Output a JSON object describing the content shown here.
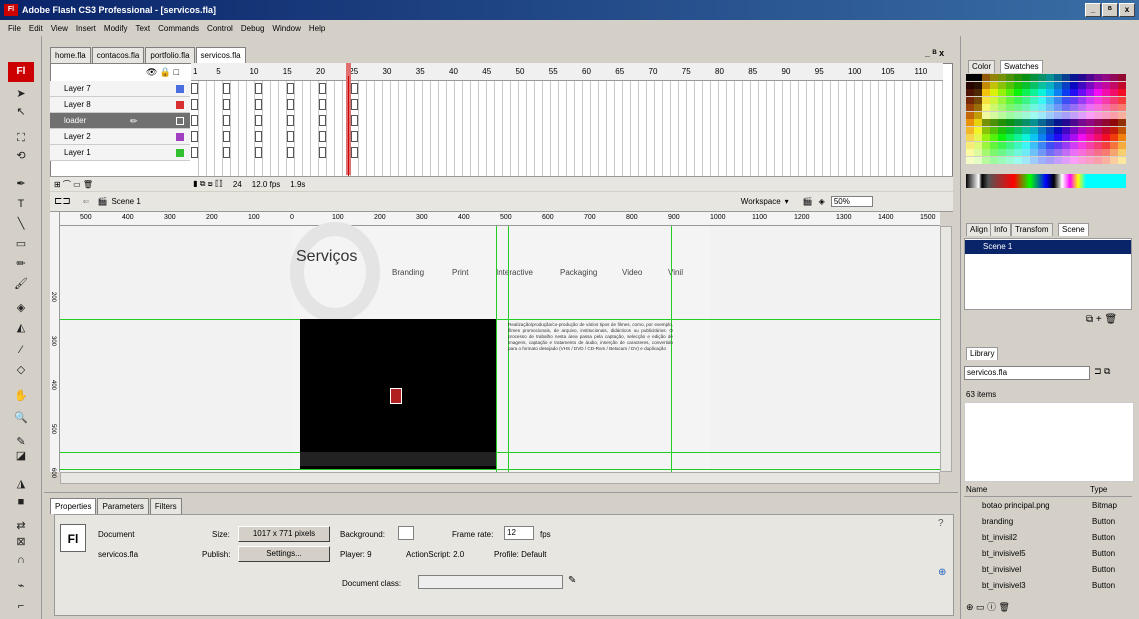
{
  "window": {
    "title": "Adobe Flash CS3 Professional - [servicos.fla]",
    "logo_text": "Fl",
    "min": "_",
    "restore": "ᴮ",
    "close": "x"
  },
  "menu": [
    "File",
    "Edit",
    "View",
    "Insert",
    "Modify",
    "Text",
    "Commands",
    "Control",
    "Debug",
    "Window",
    "Help"
  ],
  "toolbox": {
    "logo": "Fl"
  },
  "doc_tabs": [
    "home.fla",
    "contacos.fla",
    "portfolio.fla",
    "servicos.fla"
  ],
  "timeline": {
    "frame_numbers": [
      "1",
      "5",
      "10",
      "15",
      "20",
      "25",
      "30",
      "35",
      "40",
      "45",
      "50",
      "55",
      "60",
      "65",
      "70",
      "75",
      "80",
      "85",
      "90",
      "95",
      "100",
      "105",
      "110"
    ],
    "layers": [
      {
        "name": "Layer 7",
        "color": "#4a6ee0"
      },
      {
        "name": "Layer 8",
        "color": "#d83030"
      },
      {
        "name": "loader",
        "color": "#707070"
      },
      {
        "name": "Layer 2",
        "color": "#a040c0"
      },
      {
        "name": "Layer 1",
        "color": "#30c030"
      }
    ],
    "current_frame": "24",
    "fps": "12.0 fps",
    "time": "1.9s"
  },
  "scene": {
    "name": "Scene 1",
    "workspace": "Workspace",
    "zoom": "50%"
  },
  "ruler": {
    "h": [
      "500",
      "400",
      "300",
      "200",
      "100",
      "0",
      "100",
      "200",
      "300",
      "400",
      "500",
      "600",
      "700",
      "800",
      "900",
      "1000",
      "1100",
      "1200",
      "1300",
      "1400",
      "1500"
    ],
    "v": [
      "200",
      "300",
      "400",
      "500",
      "600"
    ]
  },
  "stage": {
    "heading": "Serviços",
    "nav": [
      "Branding",
      "Print",
      "Interactive",
      "Packaging",
      "Video",
      "Vinil"
    ],
    "body_text": "Realização/produção/co-produção de vários tipos de filmes, como, por exemplo, filmes promocionais, de arquivo, institucionais, didácticos ou publicitários. O processo de trabalho nesta área passa pela captação, selecção e edição de imagens, captação e tratamento de áudio, inserção de caracteres, convertido para o formato desejado (VHS / DVD / CD-Rom / Betacam / DV) e duplicação"
  },
  "properties": {
    "tabs": [
      "Properties",
      "Parameters",
      "Filters"
    ],
    "doc_label": "Document",
    "doc_name": "servicos.fla",
    "size_label": "Size:",
    "size_value": "1017 x 771 pixels",
    "background_label": "Background:",
    "frame_rate_label": "Frame rate:",
    "frame_rate_value": "12",
    "fps_label": "fps",
    "publish_label": "Publish:",
    "settings": "Settings...",
    "player": "Player: 9",
    "actionscript": "ActionScript: 2.0",
    "profile": "Profile: Default",
    "doc_class_label": "Document class:"
  },
  "color_panel": {
    "tabs": [
      "Color",
      "Swatches"
    ]
  },
  "align_panel": {
    "tabs": [
      "Align",
      "Info",
      "Transfom",
      "Scene"
    ],
    "scene_item": "Scene 1"
  },
  "library": {
    "tab": "Library",
    "file": "servicos.fla",
    "count": "63 items",
    "col_name": "Name",
    "col_type": "Type",
    "items": [
      {
        "name": "botao principal.png",
        "type": "Bitmap"
      },
      {
        "name": "branding",
        "type": "Button"
      },
      {
        "name": "bt_invisil2",
        "type": "Button"
      },
      {
        "name": "bt_invisivel5",
        "type": "Button"
      },
      {
        "name": "bt_invisivel",
        "type": "Button"
      },
      {
        "name": "bt_invisivel3",
        "type": "Button"
      }
    ]
  }
}
